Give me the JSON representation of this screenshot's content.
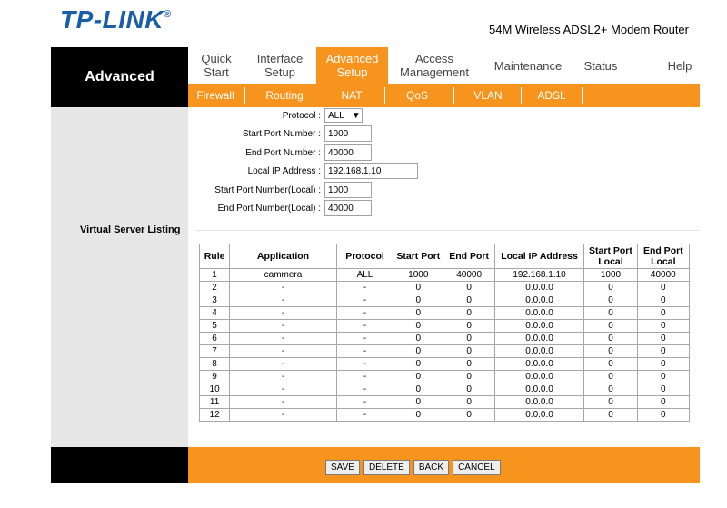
{
  "header": {
    "logo": "TP-LINK",
    "logo_mark": "®",
    "product": "54M Wireless ADSL2+ Modem Router"
  },
  "sidebar": {
    "title": "Advanced",
    "section_label": "Virtual Server Listing"
  },
  "nav": {
    "items": [
      {
        "line1": "Quick",
        "line2": "Start"
      },
      {
        "line1": "Interface",
        "line2": "Setup"
      },
      {
        "line1": "Advanced",
        "line2": "Setup"
      },
      {
        "line1": "Access",
        "line2": "Management"
      },
      {
        "line1": "Maintenance",
        "line2": ""
      },
      {
        "line1": "Status",
        "line2": ""
      },
      {
        "line1": "Help",
        "line2": ""
      }
    ],
    "active_index": 2
  },
  "subnav": {
    "items": [
      "Firewall",
      "Routing",
      "NAT",
      "QoS",
      "VLAN",
      "ADSL"
    ]
  },
  "form": {
    "protocol_label": "Protocol :",
    "protocol_value": "ALL",
    "start_port_label": "Start Port Number :",
    "start_port_value": "1000",
    "end_port_label": "End Port Number :",
    "end_port_value": "40000",
    "local_ip_label": "Local IP Address :",
    "local_ip_value": "192.168.1.10",
    "start_port_local_label": "Start Port Number(Local) :",
    "start_port_local_value": "1000",
    "end_port_local_label": "End Port Number(Local) :",
    "end_port_local_value": "40000"
  },
  "table": {
    "headers": [
      "Rule",
      "Application",
      "Protocol",
      "Start Port",
      "End Port",
      "Local IP Address",
      "Start Port Local",
      "End Port Local"
    ],
    "rows": [
      [
        "1",
        "cammera",
        "ALL",
        "1000",
        "40000",
        "192.168.1.10",
        "1000",
        "40000"
      ],
      [
        "2",
        "-",
        "-",
        "0",
        "0",
        "0.0.0.0",
        "0",
        "0"
      ],
      [
        "3",
        "-",
        "-",
        "0",
        "0",
        "0.0.0.0",
        "0",
        "0"
      ],
      [
        "4",
        "-",
        "-",
        "0",
        "0",
        "0.0.0.0",
        "0",
        "0"
      ],
      [
        "5",
        "-",
        "-",
        "0",
        "0",
        "0.0.0.0",
        "0",
        "0"
      ],
      [
        "6",
        "-",
        "-",
        "0",
        "0",
        "0.0.0.0",
        "0",
        "0"
      ],
      [
        "7",
        "-",
        "-",
        "0",
        "0",
        "0.0.0.0",
        "0",
        "0"
      ],
      [
        "8",
        "-",
        "-",
        "0",
        "0",
        "0.0.0.0",
        "0",
        "0"
      ],
      [
        "9",
        "-",
        "-",
        "0",
        "0",
        "0.0.0.0",
        "0",
        "0"
      ],
      [
        "10",
        "-",
        "-",
        "0",
        "0",
        "0.0.0.0",
        "0",
        "0"
      ],
      [
        "11",
        "-",
        "-",
        "0",
        "0",
        "0.0.0.0",
        "0",
        "0"
      ],
      [
        "12",
        "-",
        "-",
        "0",
        "0",
        "0.0.0.0",
        "0",
        "0"
      ]
    ]
  },
  "buttons": {
    "save": "SAVE",
    "delete": "DELETE",
    "back": "BACK",
    "cancel": "CANCEL"
  },
  "colors": {
    "accent": "#f7941d",
    "logo": "#1a5ea8",
    "sidebar": "#e7e7e7"
  }
}
